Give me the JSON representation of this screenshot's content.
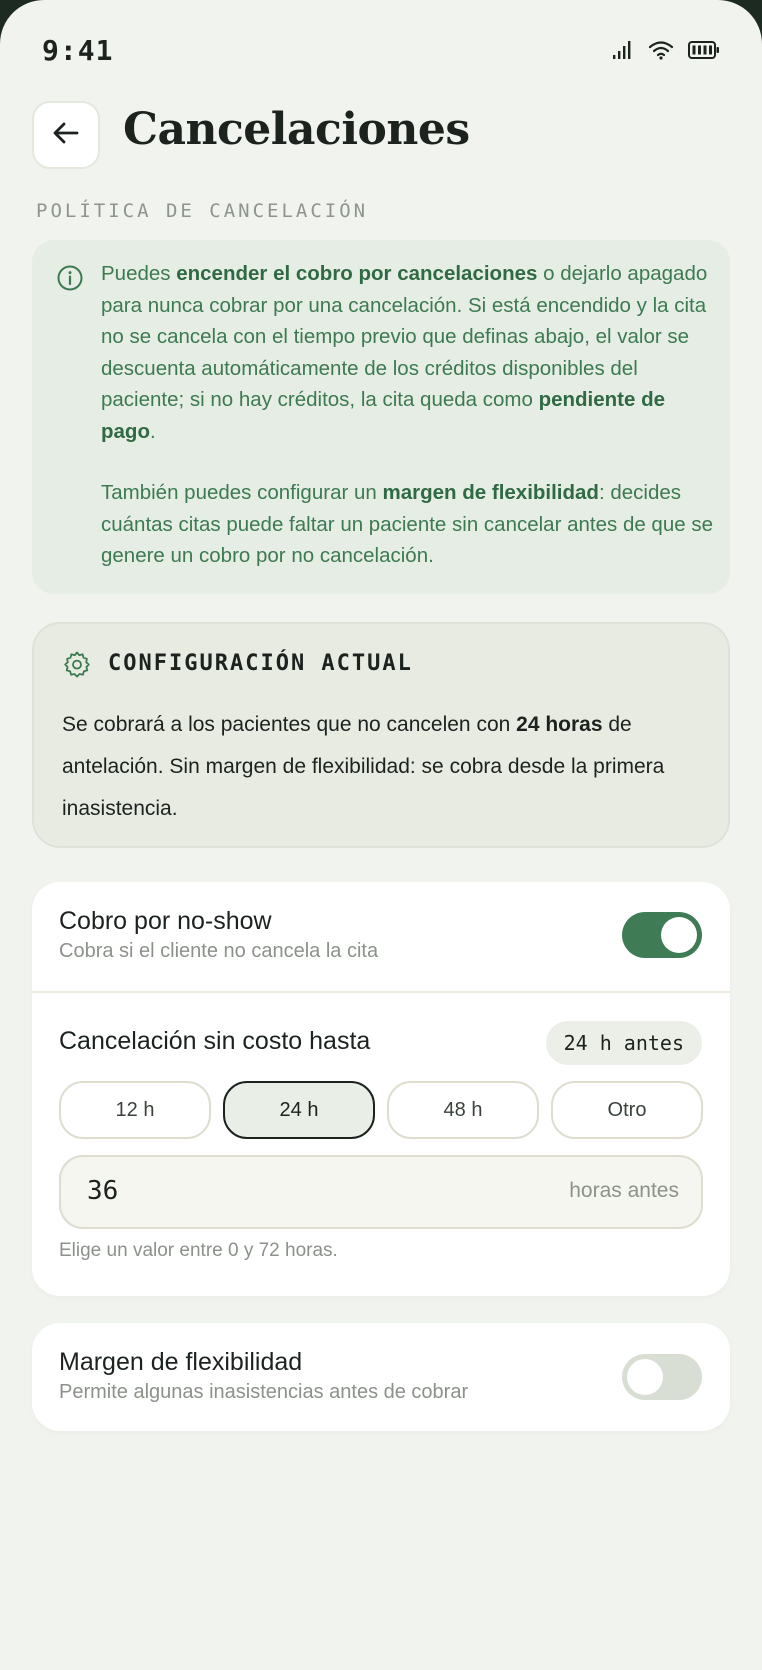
{
  "status_bar": {
    "time": "9:41",
    "icons": [
      "signal-icon",
      "wifi-icon",
      "battery-icon"
    ]
  },
  "header": {
    "back_icon": "arrow-left-icon",
    "title": "Cancelaciones"
  },
  "policy": {
    "section_label": "POLÍTICA DE CANCELACIÓN",
    "icon": "info-icon",
    "p1": {
      "t1": "Puedes ",
      "b1": "encender el cobro por cancelaciones",
      "t2": " o dejarlo apagado para nunca cobrar por una cancelación. Si está encendido y la cita no se cancela con el tiempo previo que definas abajo, el valor se descuenta automáticamente de los créditos disponibles del paciente; si no hay créditos, la cita queda como ",
      "b2": "pendiente de pago",
      "t3": "."
    },
    "p2": {
      "t1": "También puedes configurar un ",
      "b1": "margen de flexibilidad",
      "t2": ": decides cuántas citas puede faltar un paciente sin cancelar antes de que se genere un cobro por no cancelación."
    }
  },
  "current_config": {
    "icon": "gear-icon",
    "title": "CONFIGURACIÓN ACTUAL",
    "t1": "Se cobrará a los pacientes que no cancelen con ",
    "b1": "24 horas",
    "t2": " de antelación. Sin margen de flexibilidad: se cobra desde la primera inasistencia."
  },
  "no_show": {
    "title": "Cobro por no-show",
    "subtitle": "Cobra si el cliente no cancela la cita",
    "enabled": true
  },
  "free_cancel": {
    "label": "Cancelación sin costo hasta",
    "badge": "24 h antes",
    "options": [
      "12 h",
      "24 h",
      "48 h",
      "Otro"
    ],
    "selected": "24 h",
    "input_value": "36",
    "input_unit": "horas antes",
    "helper": "Elige un valor entre 0 y 72  horas."
  },
  "flex_margin": {
    "title": "Margen de flexibilidad",
    "subtitle": "Permite algunas inasistencias antes de cobrar",
    "enabled": false
  },
  "colors": {
    "background": "#f1f4ee",
    "accent_green": "#3f7b55",
    "info_text": "#3c7a52",
    "info_bg": "#e6ede4",
    "text": "#1c231f",
    "muted": "#8b928a"
  }
}
